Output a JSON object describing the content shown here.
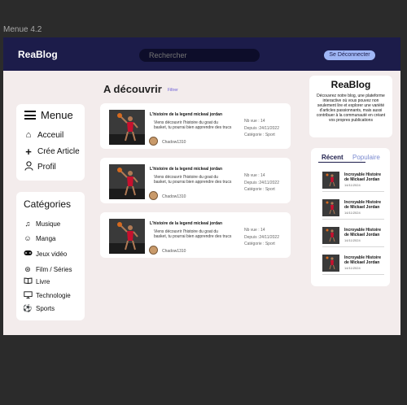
{
  "frame_label": "Menue 4.2",
  "header": {
    "logo": "ReaBlog",
    "search_placeholder": "Rechercher",
    "logout_label": "Se Déconnecter"
  },
  "menu": {
    "title": "Menue",
    "items": [
      {
        "label": "Acceuil",
        "icon": "home-icon"
      },
      {
        "label": "Crée Article",
        "icon": "plus-icon"
      },
      {
        "label": "Profil",
        "icon": "user-icon"
      }
    ]
  },
  "categories": {
    "title": "Catégories",
    "items": [
      {
        "label": "Musique",
        "icon": "music-icon"
      },
      {
        "label": "Manga",
        "icon": "manga-icon"
      },
      {
        "label": "Jeux vidéo",
        "icon": "gamepad-icon"
      },
      {
        "label": "Film / Séries",
        "icon": "film-icon"
      },
      {
        "label": "Livre",
        "icon": "book-icon"
      },
      {
        "label": "Technologie",
        "icon": "monitor-icon"
      },
      {
        "label": "Sports",
        "icon": "ball-icon"
      }
    ]
  },
  "main": {
    "title": "A découvrir",
    "filter_label": "Filtrer",
    "posts": [
      {
        "title": "L'histoire de la legend mickeal jordan",
        "description": "Viens découvrir l'histoire du goat du basket, tu pourrai bien apprendre des trucs",
        "author": "Chadow1310",
        "views": "Nb vue : 14",
        "date": "Depuis :24/11/2022",
        "category": "Catégorie : Sport"
      },
      {
        "title": "L'histoire de la legend mickeal jordan",
        "description": "Viens découvrir l'histoire du goat du basket, tu pourrai bien apprendre des trucs",
        "author": "Chadow1310",
        "views": "Nb vue : 14",
        "date": "Depuis :24/11/2022",
        "category": "Catégorie : Sport"
      },
      {
        "title": "L'histoire de la legend mickeal jordan",
        "description": "Viens découvrir l'histoire du goat du basket, tu pourrai bien apprendre des trucs",
        "author": "Chadow1310",
        "views": "Nb vue : 14",
        "date": "Depuis :24/11/2022",
        "category": "Catégorie : Sport"
      }
    ]
  },
  "about": {
    "title": "ReaBlog",
    "text": "Découvrez notre blog, une plateforme interactive où vous pouvez non seulement lire et explorer une variété d'articles passionnants, mais aussi contribuer à la communauté en créant vos propres publications"
  },
  "sidebar": {
    "tab_recent": "Récent",
    "tab_popular": "Populaire",
    "items": [
      {
        "title": "Incroyable Histoire de Mickael Jordan",
        "date": "14/11/2024"
      },
      {
        "title": "Incroyable Histoire de Mickael Jordan",
        "date": "14/11/2024"
      },
      {
        "title": "Incroyable Histoire de Mickael Jordan",
        "date": "14/11/2024"
      },
      {
        "title": "Incroyable Histoire de Mickael Jordan",
        "date": "14/11/2024"
      }
    ]
  },
  "colors": {
    "header_bg": "#1c1c4a",
    "page_bg": "#f3ecec",
    "accent": "#9fb6f5"
  }
}
